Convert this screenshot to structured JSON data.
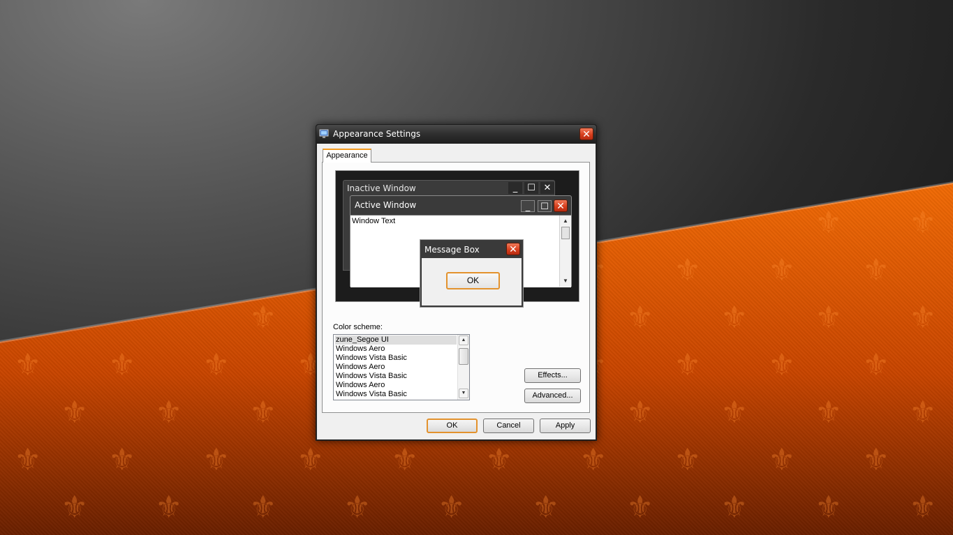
{
  "dialog": {
    "title": "Appearance Settings",
    "close_glyph": "✕",
    "tab_label": "Appearance",
    "icon": "display-settings-icon"
  },
  "preview": {
    "inactive_title": "Inactive Window",
    "active_title": "Active Window",
    "window_text": "Window Text",
    "message_box_title": "Message Box",
    "message_box_ok": "OK",
    "minimize_glyph": "_",
    "maximize_glyph": "☐",
    "close_glyph": "✕"
  },
  "color_scheme": {
    "label": "Color scheme:",
    "items": [
      "zune_Segoe UI",
      "Windows Aero",
      "Windows Vista Basic",
      "Windows Aero",
      "Windows Vista Basic",
      "Windows Aero",
      "Windows Vista Basic"
    ],
    "selected": "zune_Segoe UI"
  },
  "buttons": {
    "effects": "Effects...",
    "advanced": "Advanced...",
    "ok": "OK",
    "cancel": "Cancel",
    "apply": "Apply"
  },
  "colors": {
    "accent": "#e3922d",
    "close_red": "#d8401e",
    "wallpaper_orange": "#f06a05"
  }
}
